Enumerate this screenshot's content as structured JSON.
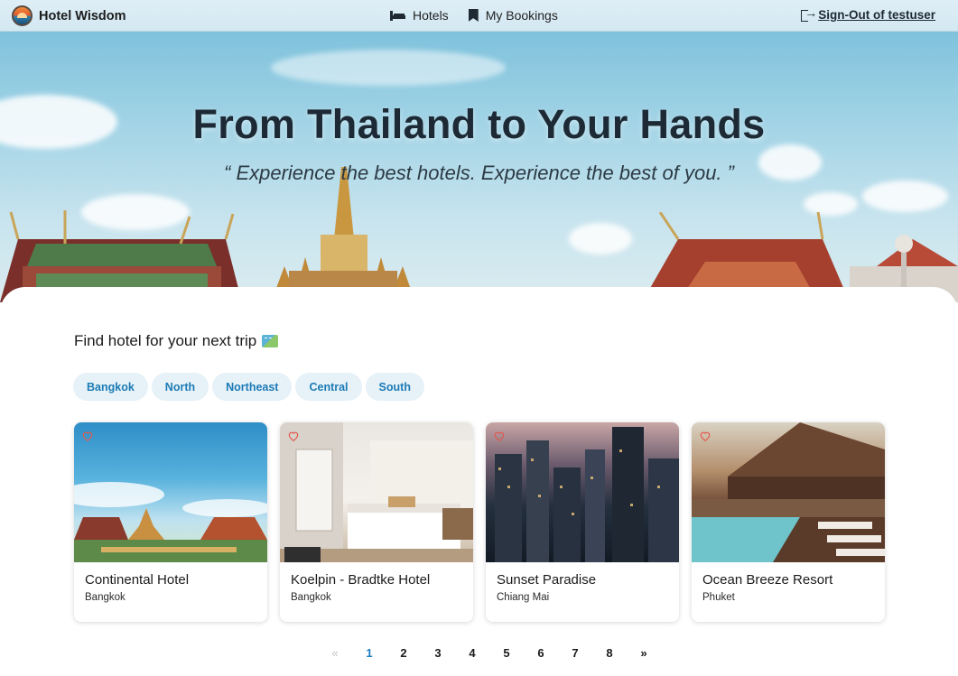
{
  "nav": {
    "brand": "Hotel Wisdom",
    "links": [
      {
        "label": "Hotels",
        "icon": "bed-icon"
      },
      {
        "label": "My Bookings",
        "icon": "bookmark-icon"
      }
    ],
    "signout": "Sign-Out of testuser"
  },
  "hero": {
    "title": "From Thailand to Your Hands",
    "quote": "“ Experience the best hotels. Experience the best of you. ”"
  },
  "search": {
    "title": "Find hotel for your next trip",
    "icon": "map-icon"
  },
  "regions": [
    "Bangkok",
    "North",
    "Northeast",
    "Central",
    "South"
  ],
  "hotels": [
    {
      "name": "Continental Hotel",
      "city": "Bangkok",
      "image": "temple-photo"
    },
    {
      "name": "Koelpin - Bradtke Hotel",
      "city": "Bangkok",
      "image": "bedroom-photo"
    },
    {
      "name": "Sunset Paradise",
      "city": "Chiang Mai",
      "image": "city-night-photo"
    },
    {
      "name": "Ocean Breeze Resort",
      "city": "Phuket",
      "image": "resort-pool-photo"
    }
  ],
  "pagination": {
    "prev": "«",
    "next": "»",
    "pages": [
      "1",
      "2",
      "3",
      "4",
      "5",
      "6",
      "7",
      "8"
    ],
    "current": "1"
  },
  "colors": {
    "accent": "#1c7bb5",
    "chip_bg": "#e6f1f8",
    "active_page": "#1e7ec0",
    "heart": "#e2574c"
  }
}
